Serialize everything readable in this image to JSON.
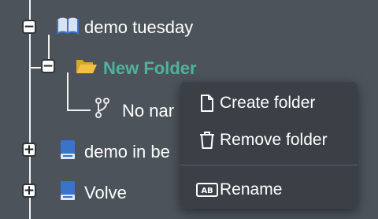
{
  "tree": {
    "nodes": [
      {
        "label": "demo tuesday",
        "toggle": "−",
        "icon": "book-icon"
      },
      {
        "label": "New Folder",
        "toggle": "−",
        "icon": "folder-open-icon",
        "active": true
      },
      {
        "label": "No nar",
        "icon": "branch-icon"
      },
      {
        "label": "demo in be",
        "toggle": "+",
        "icon": "blue-book-icon"
      },
      {
        "label": "Volve",
        "toggle": "+",
        "icon": "blue-book-icon"
      }
    ]
  },
  "context_menu": {
    "items": [
      {
        "label": "Create folder",
        "icon": "file-icon"
      },
      {
        "label": "Remove folder",
        "icon": "trash-icon"
      },
      {
        "label": "Rename",
        "icon": "ab-rename-icon"
      }
    ]
  },
  "colors": {
    "background": "#4c535a",
    "active_text": "#4fb39b",
    "menu_background": "#3a4046",
    "folder_yellow": "#f2c144",
    "book_blue": "#3a74c9"
  }
}
